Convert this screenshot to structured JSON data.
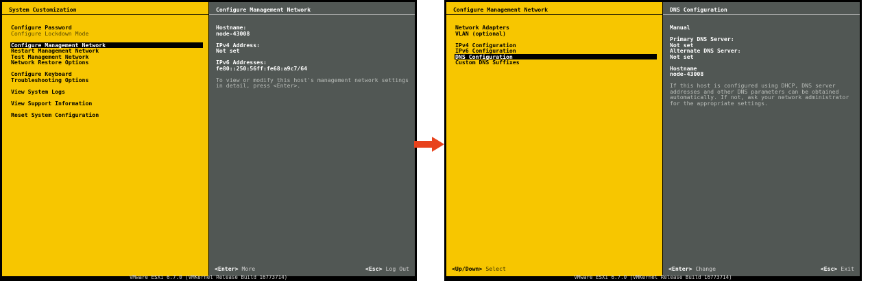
{
  "left_screen": {
    "menu_title": "System Customization",
    "menu_items": [
      {
        "label": "Configure Password",
        "state": "normal"
      },
      {
        "label": "Configure Lockdown Mode",
        "state": "dim"
      },
      {
        "label": "",
        "state": "gap"
      },
      {
        "label": "Configure Management Network",
        "state": "selected"
      },
      {
        "label": "Restart Management Network",
        "state": "normal"
      },
      {
        "label": "Test Management Network",
        "state": "normal"
      },
      {
        "label": "Network Restore Options",
        "state": "normal"
      },
      {
        "label": "",
        "state": "gap"
      },
      {
        "label": "Configure Keyboard",
        "state": "normal"
      },
      {
        "label": "Troubleshooting Options",
        "state": "normal"
      },
      {
        "label": "",
        "state": "gap"
      },
      {
        "label": "View System Logs",
        "state": "normal"
      },
      {
        "label": "",
        "state": "gap"
      },
      {
        "label": "View Support Information",
        "state": "normal"
      },
      {
        "label": "",
        "state": "gap"
      },
      {
        "label": "Reset System Configuration",
        "state": "normal"
      }
    ],
    "detail_title": "Configure Management Network",
    "hostname_label": "Hostname:",
    "hostname_value": "node-43008",
    "ipv4_label": "IPv4 Address:",
    "ipv4_value": "Not set",
    "ipv6_label": "IPv6 Addresses:",
    "ipv6_value": "fe80::250:56ff:fe68:a9c7/64",
    "note": "To view or modify this host's management network settings in detail, press <Enter>.",
    "footer_left_key": "<Enter>",
    "footer_left_action": "More",
    "footer_right_key": "<Esc>",
    "footer_right_action": "Log Out",
    "status_bar": "VMware ESXi 6.7.0 (VMKernel Release Build 16773714)"
  },
  "right_screen": {
    "menu_title": "Configure Management Network",
    "menu_items": [
      {
        "label": "Network Adapters",
        "state": "normal"
      },
      {
        "label": "VLAN (optional)",
        "state": "normal"
      },
      {
        "label": "",
        "state": "gap"
      },
      {
        "label": "IPv4 Configuration",
        "state": "normal"
      },
      {
        "label": "IPv6 Configuration",
        "state": "normal"
      },
      {
        "label": "DNS Configuration",
        "state": "selected"
      },
      {
        "label": "Custom DNS Suffixes",
        "state": "normal"
      }
    ],
    "detail_title": "DNS Configuration",
    "mode_value": "Manual",
    "primary_dns_label": "Primary DNS Server:",
    "primary_dns_value": "Not set",
    "alternate_dns_label": "Alternate DNS Server:",
    "alternate_dns_value": "Not set",
    "hostname_label": "Hostname",
    "hostname_value": "node-43008",
    "note": "If this host is configured using DHCP, DNS server addresses and other DNS parameters can be obtained automatically. If not, ask your network administrator for the appropriate settings.",
    "footer_menu_key": "<Up/Down>",
    "footer_menu_action": "Select",
    "footer_left_key": "<Enter>",
    "footer_left_action": "Change",
    "footer_right_key": "<Esc>",
    "footer_right_action": "Exit",
    "status_bar": "VMware ESXi 6.7.0 (VMKernel Release Build 16773714)"
  },
  "colors": {
    "menu_panel": "#f7c600",
    "detail_panel": "#515754",
    "arrow": "#e8421c"
  },
  "icons": {
    "transition_arrow": "right-arrow-icon"
  }
}
